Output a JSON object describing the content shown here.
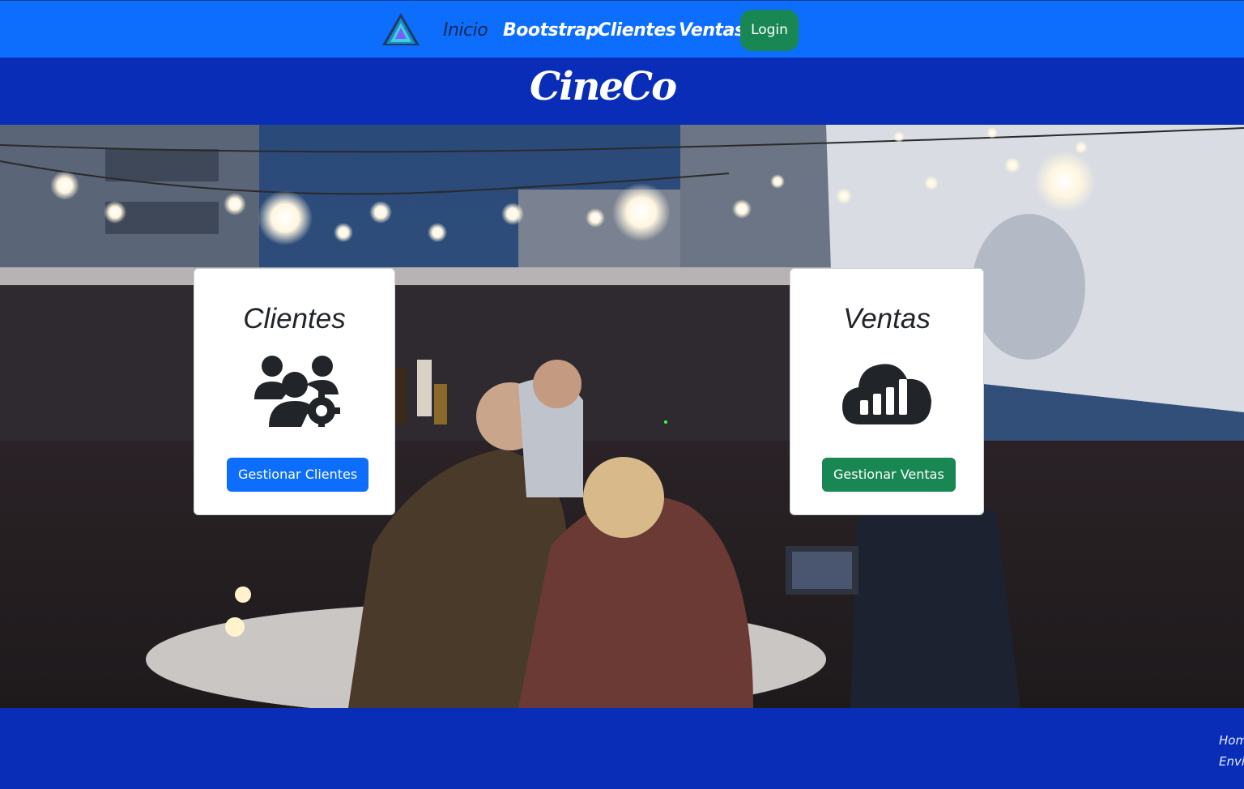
{
  "nav": {
    "links": [
      {
        "label": "Inicio"
      },
      {
        "label": "Bootstrap"
      },
      {
        "label": "Clientes"
      },
      {
        "label": "Ventas"
      }
    ],
    "login_label": "Login",
    "logo_icon": "triangle-logo-icon"
  },
  "brand": {
    "name": "CineCo"
  },
  "cards": {
    "clientes": {
      "title": "Clientes",
      "icon": "users-gear-icon",
      "button_label": "Gestionar Clientes"
    },
    "ventas": {
      "title": "Ventas",
      "icon": "cloud-chart-icon",
      "button_label": "Gestionar Ventas"
    }
  },
  "footer": {
    "line1": "Hom",
    "line2": "Envi"
  },
  "colors": {
    "nav_bg": "#0d6efd",
    "brand_bg": "#0a2db8",
    "primary": "#0d6efd",
    "success": "#198754"
  }
}
